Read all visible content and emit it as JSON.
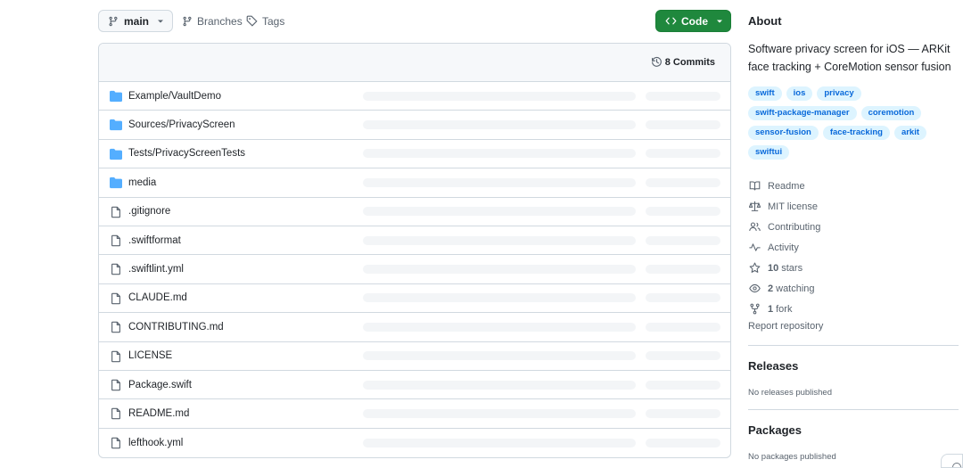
{
  "toolbar": {
    "branch_label": "main",
    "branches_label": "Branches",
    "tags_label": "Tags",
    "code_label": "Code"
  },
  "commits": {
    "count_label": "8 Commits"
  },
  "files": [
    {
      "name": "Example/VaultDemo",
      "type": "folder"
    },
    {
      "name": "Sources/PrivacyScreen",
      "type": "folder"
    },
    {
      "name": "Tests/PrivacyScreenTests",
      "type": "folder"
    },
    {
      "name": "media",
      "type": "folder"
    },
    {
      "name": ".gitignore",
      "type": "file"
    },
    {
      "name": ".swiftformat",
      "type": "file"
    },
    {
      "name": ".swiftlint.yml",
      "type": "file"
    },
    {
      "name": "CLAUDE.md",
      "type": "file"
    },
    {
      "name": "CONTRIBUTING.md",
      "type": "file"
    },
    {
      "name": "LICENSE",
      "type": "file"
    },
    {
      "name": "Package.swift",
      "type": "file"
    },
    {
      "name": "README.md",
      "type": "file"
    },
    {
      "name": "lefthook.yml",
      "type": "file"
    }
  ],
  "about": {
    "heading": "About",
    "description": "Software privacy screen for iOS — ARKit face tracking + CoreMotion sensor fusion",
    "topics": [
      "swift",
      "ios",
      "privacy",
      "swift-package-manager",
      "coremotion",
      "sensor-fusion",
      "face-tracking",
      "arkit",
      "swiftui"
    ],
    "meta": {
      "readme": "Readme",
      "license": "MIT license",
      "contributing": "Contributing",
      "activity": "Activity",
      "stars_count": "10",
      "stars_label": "stars",
      "watching_count": "2",
      "watching_label": "watching",
      "forks_count": "1",
      "forks_label": "fork"
    },
    "report": "Report repository"
  },
  "releases": {
    "heading": "Releases",
    "empty": "No releases published"
  },
  "packages": {
    "heading": "Packages",
    "empty": "No packages published"
  },
  "colors": {
    "accent": "#0969da",
    "code_button": "#1f883d",
    "folder_icon": "#54aeff",
    "topic_bg": "#ddf4ff"
  }
}
